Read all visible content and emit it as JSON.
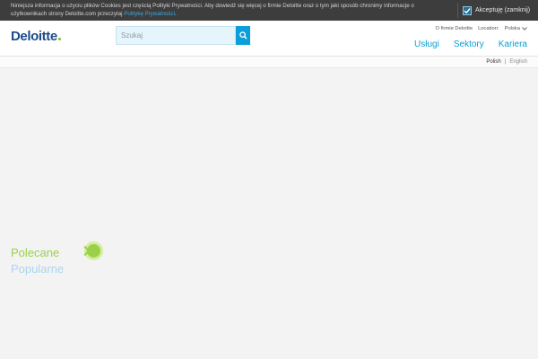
{
  "cookie_bar": {
    "text_part1": "Niniejsza informacja o użyciu plików Cookies jest częścią Polityki Prywatności. Aby dowiedź się więcej o firmie Deloitte oraz o tym jaki sposób chronimy informacje o użytkownikach strony Deloitte.com przeczytaj ",
    "link_text": "Politykę Prywatności",
    "text_end": ".",
    "accept_label": "Akceptuję (zamknij)"
  },
  "header": {
    "logo_text": "Deloitte",
    "search_placeholder": "Szukaj",
    "about_link": "O firmie Deloitte",
    "location_label": "Location:",
    "location_value": "Polska",
    "nav": [
      "Usługi",
      "Sektory",
      "Kariera"
    ]
  },
  "language_bar": {
    "active": "Polish",
    "separator": "|",
    "other": "English"
  },
  "main": {
    "polecane": "Polecane",
    "popularne": "Popularne"
  },
  "colors": {
    "brand_blue": "#1b4b8a",
    "accent_blue": "#0a9fd8",
    "accent_green": "#9bd14a"
  }
}
